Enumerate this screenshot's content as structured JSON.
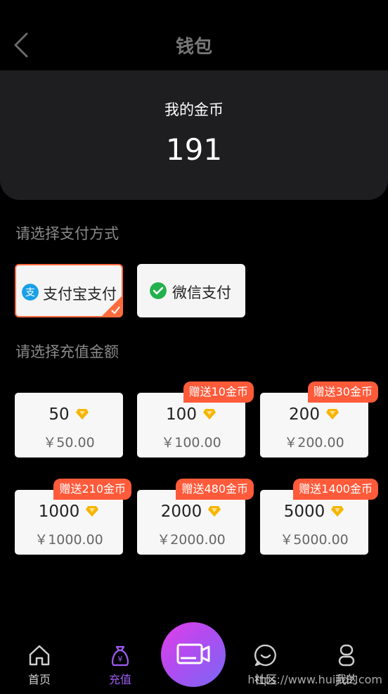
{
  "header": {
    "title": "钱包"
  },
  "balance": {
    "label": "我的金币",
    "value": "191"
  },
  "payment": {
    "section_label": "请选择支付方式",
    "methods": [
      {
        "label": "支付宝支付",
        "icon": "alipay-icon",
        "selected": true
      },
      {
        "label": "微信支付",
        "icon": "wechat-pay-icon",
        "selected": false
      }
    ]
  },
  "recharge": {
    "section_label": "请选择充值金额",
    "options": [
      {
        "coins": "50",
        "price": "￥50.00",
        "bonus": ""
      },
      {
        "coins": "100",
        "price": "￥100.00",
        "bonus": "赠送10金币"
      },
      {
        "coins": "200",
        "price": "￥200.00",
        "bonus": "赠送30金币"
      },
      {
        "coins": "1000",
        "price": "￥1000.00",
        "bonus": "赠送210金币"
      },
      {
        "coins": "2000",
        "price": "￥2000.00",
        "bonus": "赠送480金币"
      },
      {
        "coins": "5000",
        "price": "￥5000.00",
        "bonus": "赠送1400金币"
      }
    ]
  },
  "tabbar": {
    "items": [
      {
        "label": "首页",
        "icon": "home-icon",
        "active": false
      },
      {
        "label": "充值",
        "icon": "money-bag-icon",
        "active": true
      },
      {
        "label": "社区",
        "icon": "chat-icon",
        "active": false
      },
      {
        "label": "我的",
        "icon": "profile-icon",
        "active": false
      }
    ],
    "center_icon": "video-icon"
  },
  "colors": {
    "accent": "#ff5a3a",
    "active_tab": "#a05bf5",
    "background": "#000000"
  },
  "watermark": "https://www.huijidz.com"
}
